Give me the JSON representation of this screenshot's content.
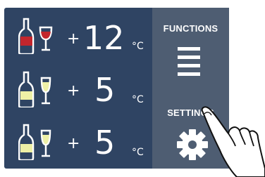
{
  "zones": [
    {
      "sign": "+",
      "value": "12",
      "unit": "°C",
      "icon": "red-wine-bottle-glass-icon",
      "wine_color": "#c3262d"
    },
    {
      "sign": "+",
      "value": "5",
      "unit": "°C",
      "icon": "white-wine-bottle-glass-icon",
      "wine_color": "#eef0a6"
    },
    {
      "sign": "+",
      "value": "5",
      "unit": "°C",
      "icon": "sparkling-wine-bottle-glass-icon",
      "wine_color": "#eef0a6"
    }
  ],
  "side_panel": {
    "functions_label": "FUNCTIONS",
    "settings_label": "SETTINGS",
    "functions_icon": "menu-icon",
    "settings_icon": "gear-icon"
  },
  "colors": {
    "screen_background": "#2f4463",
    "side_panel_background": "#4e5d72",
    "text": "#ffffff"
  }
}
